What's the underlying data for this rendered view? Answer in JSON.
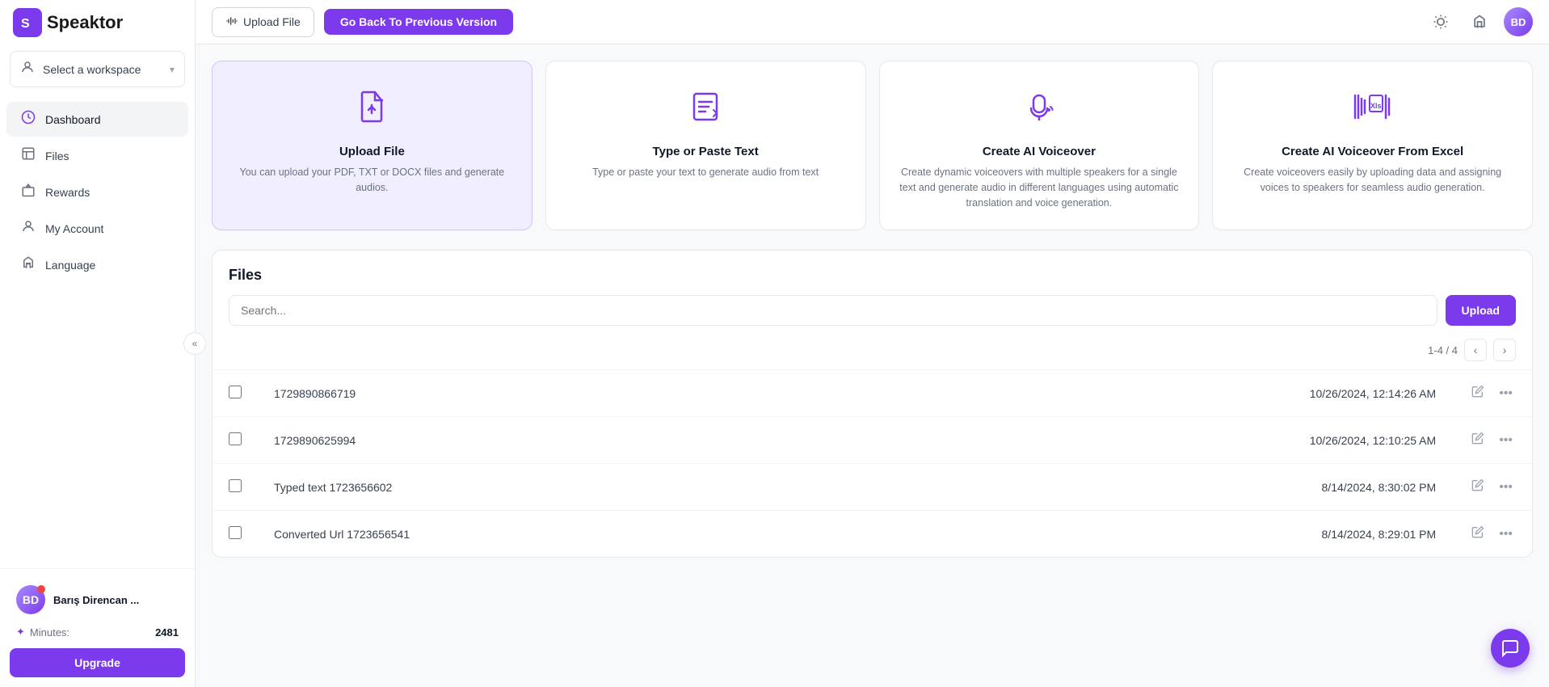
{
  "app": {
    "name": "Speaktor",
    "logo_letter": "S"
  },
  "sidebar": {
    "workspace": {
      "label": "Select a workspace",
      "chevron": "▾"
    },
    "nav_items": [
      {
        "id": "dashboard",
        "label": "Dashboard",
        "active": true
      },
      {
        "id": "files",
        "label": "Files",
        "active": false
      },
      {
        "id": "rewards",
        "label": "Rewards",
        "active": false
      },
      {
        "id": "my-account",
        "label": "My Account",
        "active": false
      },
      {
        "id": "language",
        "label": "Language",
        "active": false
      }
    ],
    "user": {
      "name": "Barış Direncan ...",
      "initials": "BD"
    },
    "minutes": {
      "label": "Minutes:",
      "value": "2481"
    },
    "upgrade_label": "Upgrade"
  },
  "topbar": {
    "upload_file_label": "Upload File",
    "prev_version_label": "Go Back To Previous Version"
  },
  "feature_cards": [
    {
      "id": "upload-file",
      "title": "Upload File",
      "description": "You can upload your PDF, TXT or DOCX files and generate audios.",
      "highlighted": true
    },
    {
      "id": "type-paste",
      "title": "Type or Paste Text",
      "description": "Type or paste your text to generate audio from text",
      "highlighted": false
    },
    {
      "id": "ai-voiceover",
      "title": "Create AI Voiceover",
      "description": "Create dynamic voiceovers with multiple speakers for a single text and generate audio in different languages using automatic translation and voice generation.",
      "highlighted": false
    },
    {
      "id": "ai-voiceover-excel",
      "title": "Create AI Voiceover From Excel",
      "description": "Create voiceovers easily by uploading data and assigning voices to speakers for seamless audio generation.",
      "highlighted": false
    }
  ],
  "files_section": {
    "title": "Files",
    "search_placeholder": "Search...",
    "upload_label": "Upload",
    "pagination": "1-4 / 4",
    "files": [
      {
        "id": "f1",
        "name": "1729890866719",
        "date": "10/26/2024, 12:14:26 AM"
      },
      {
        "id": "f2",
        "name": "1729890625994",
        "date": "10/26/2024, 12:10:25 AM"
      },
      {
        "id": "f3",
        "name": "Typed text 1723656602",
        "date": "8/14/2024, 8:30:02 PM"
      },
      {
        "id": "f4",
        "name": "Converted Url 1723656541",
        "date": "8/14/2024, 8:29:01 PM"
      }
    ]
  },
  "colors": {
    "primary": "#7c3aed",
    "primary_light": "#f0eeff"
  }
}
